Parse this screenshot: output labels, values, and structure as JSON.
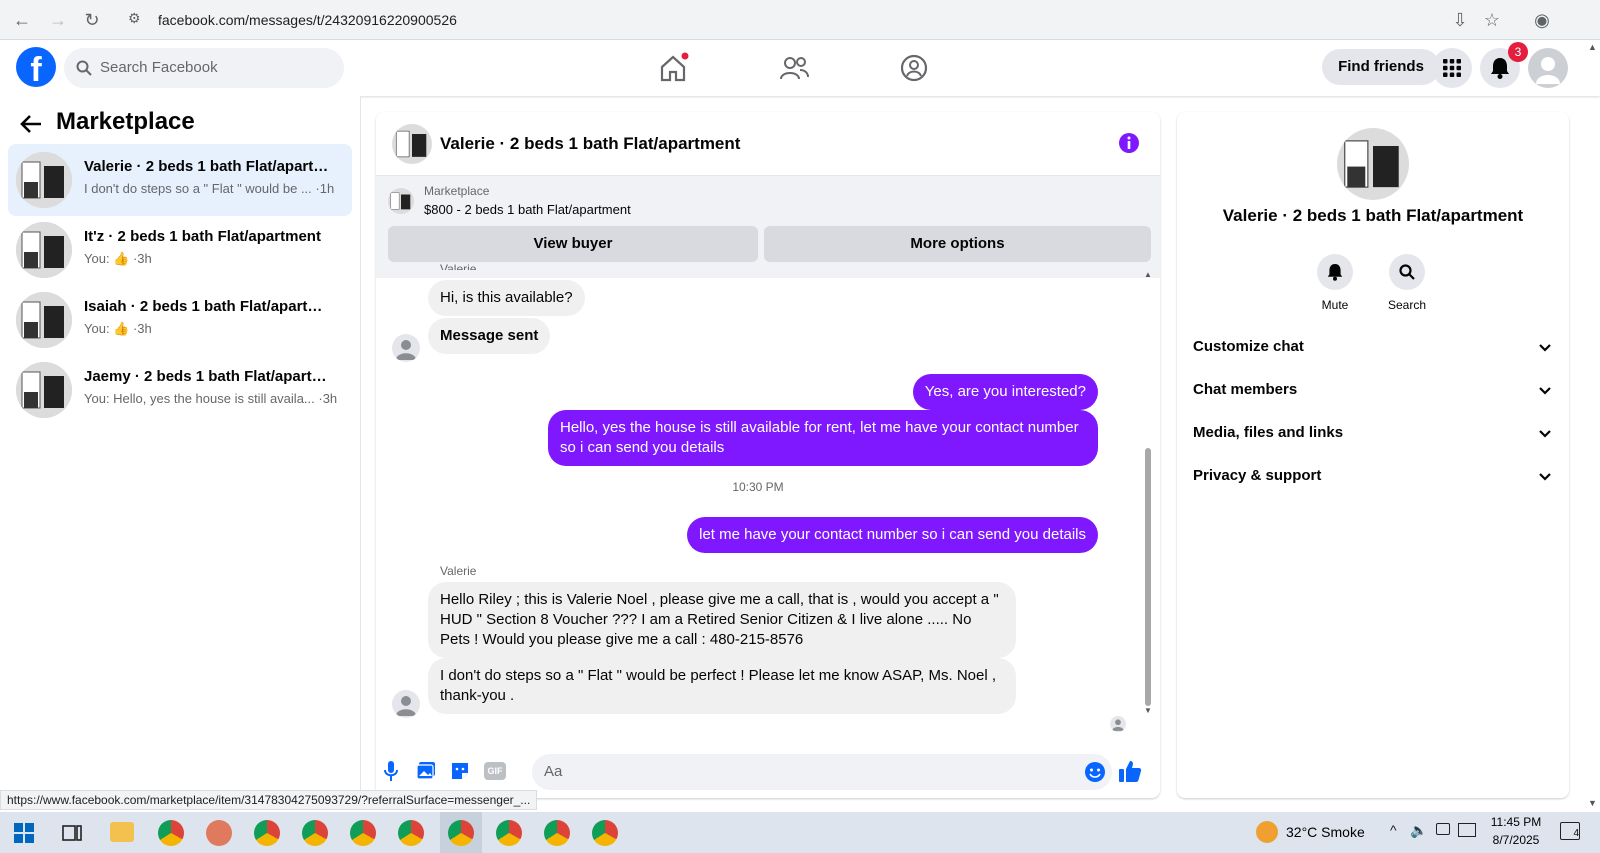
{
  "browser": {
    "url": "facebook.com/messages/t/24320916220900526"
  },
  "header": {
    "search_placeholder": "Search Facebook",
    "find_friends": "Find friends",
    "notif_count": "3"
  },
  "left": {
    "title": "Marketplace",
    "conversations": [
      {
        "title": "Valerie · 2 beds 1 bath Flat/apartm...",
        "snippet": "I don't do steps so a \" Flat \" would be ... ·1h"
      },
      {
        "title": "It'z · 2 beds 1 bath Flat/apartment",
        "snippet": "You: 👍 ·3h"
      },
      {
        "title": "Isaiah · 2 beds 1 bath Flat/apartment",
        "snippet": "You: 👍 ·3h"
      },
      {
        "title": "Jaemy · 2 beds 1 bath Flat/apartm...",
        "snippet": "You: Hello, yes the house is still availa... ·3h"
      }
    ]
  },
  "chat": {
    "title": "Valerie · 2 beds 1 bath Flat/apartment",
    "marketplace_label": "Marketplace",
    "listing": "$800 - 2 beds 1 bath Flat/apartment",
    "view_buyer": "View buyer",
    "more_options": "More options",
    "sender_top": "Valerie",
    "msg1": "Hi, is this available?",
    "msg2": "Message sent",
    "out1": "Yes, are you interested?",
    "out2": "Hello, yes the house is still available for rent, let me have your contact number so i can send you details",
    "timestamp": "10:30 PM",
    "out3": "let me have your contact number so i can send you details",
    "sender": "Valerie",
    "in3": "Hello Riley ; this is Valerie Noel , please give me a call, that is , would you accept a \" HUD \" Section 8 Voucher ??? I am a Retired Senior Citizen & I live alone ..... No Pets ! Would you please give me a call : 480-215-8576",
    "in4": "I don't do steps so a \" Flat \" would be perfect !    Please let me know ASAP,  Ms. Noel , thank-you .",
    "input_placeholder": "Aa"
  },
  "right": {
    "title": "Valerie · 2 beds 1 bath Flat/apartment",
    "mute": "Mute",
    "search": "Search",
    "sections": [
      "Customize chat",
      "Chat members",
      "Media, files and links",
      "Privacy & support"
    ]
  },
  "status_url": "https://www.facebook.com/marketplace/item/31478304275093729/?referralSurface=messenger_...",
  "taskbar": {
    "weather": "32°C  Smoke",
    "time": "11:45 PM",
    "date": "8/7/2025",
    "notif": "4"
  },
  "colors": {
    "accent": "#7f18ff",
    "brand": "#0866ff"
  }
}
